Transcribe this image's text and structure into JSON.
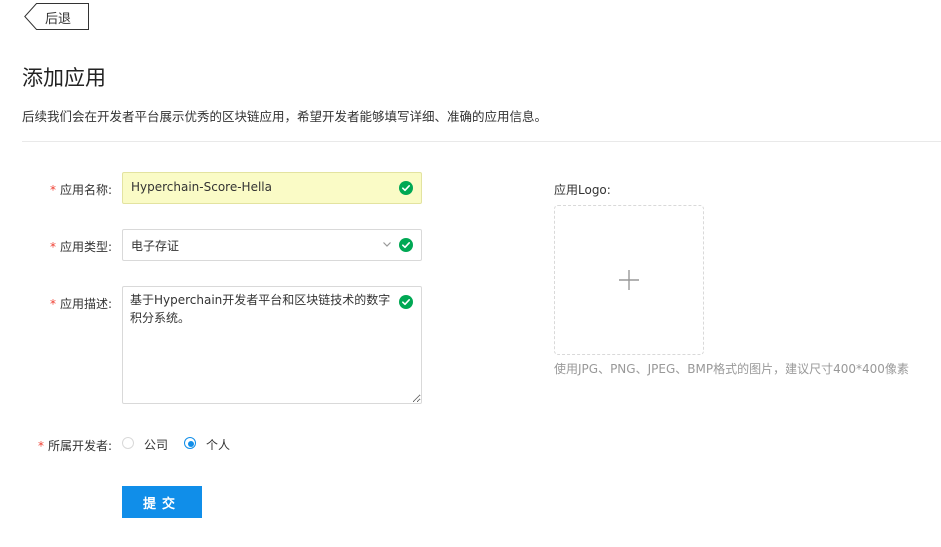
{
  "back": {
    "label": "后退"
  },
  "page": {
    "title": "添加应用",
    "description": "后续我们会在开发者平台展示优秀的区块链应用，希望开发者能够填写详细、准确的应用信息。"
  },
  "form": {
    "required_mark": "*",
    "name": {
      "label": "应用名称:",
      "value": "Hyperchain-Score-Hella"
    },
    "type": {
      "label": "应用类型:",
      "value": "电子存证"
    },
    "desc": {
      "label": "应用描述:",
      "value": "基于Hyperchain开发者平台和区块链技术的数字积分系统。"
    },
    "developer": {
      "label": "所属开发者:",
      "options": [
        {
          "label": "公司",
          "checked": false
        },
        {
          "label": "个人",
          "checked": true
        }
      ]
    },
    "submit_label": "提交"
  },
  "logo": {
    "label": "应用Logo:",
    "hint": "使用JPG、PNG、JPEG、BMP格式的图片，建议尺寸400*400像素"
  },
  "colors": {
    "primary": "#108ee9",
    "success": "#00a854",
    "required": "#f04134",
    "autofill": "#fafbc6"
  },
  "icons": {
    "check": "check-circle-icon",
    "chevron": "chevron-down-icon",
    "plus": "plus-icon"
  }
}
